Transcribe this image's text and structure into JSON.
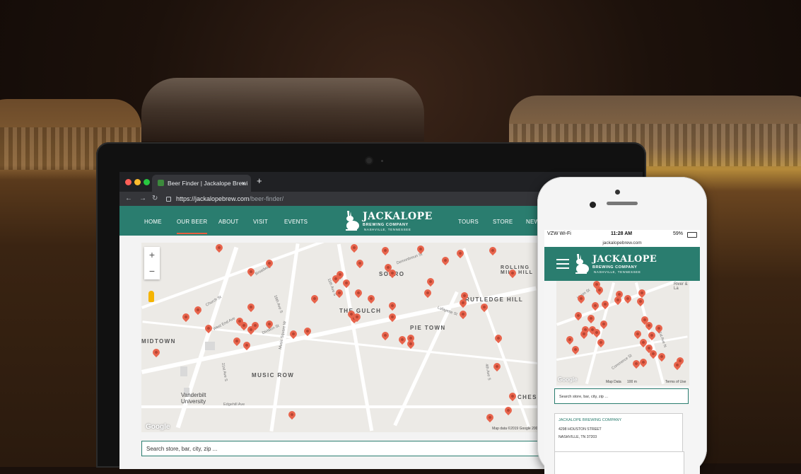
{
  "browser": {
    "tab_title": "Beer Finder | Jackalope Brewi",
    "tab_close": "×",
    "new_tab": "+",
    "url_host": "https://jackalopebrew.com",
    "url_path": "/beer-finder/",
    "traffic_lights": [
      "#ff5f57",
      "#febc2e",
      "#28c840"
    ]
  },
  "site": {
    "nav_left": [
      "HOME",
      "OUR BEER",
      "ABOUT",
      "VISIT",
      "EVENTS"
    ],
    "nav_right": [
      "TOURS",
      "STORE",
      "NEW"
    ],
    "active_item": "OUR BEER",
    "logo": {
      "name": "JACKALOPE",
      "tagline": "BREWING COMPANY",
      "location": "NASHVILLE, TENNESSEE"
    },
    "brand_color": "#2a7d6f",
    "accent_color": "#e85d3f"
  },
  "map": {
    "zoom_in": "+",
    "zoom_out": "−",
    "labels": [
      "SOBRO",
      "THE GULCH",
      "PIE TOWN",
      "RUTLEDGE HILL",
      "ROLLING MILL HILL",
      "MIDTOWN",
      "MUSIC ROW",
      "Vanderbilt University",
      "CHEST"
    ],
    "streets": [
      "Broadway",
      "West End Ave",
      "Church St",
      "Demonbreun St",
      "11th Ave S",
      "Lafayette St",
      "16th Ave S",
      "21st Ave S",
      "Edgehill Ave",
      "Division St",
      "Music Square W",
      "4th Ave S"
    ],
    "google": "Google",
    "footer": "Map data ©2019 Google   200 m"
  },
  "search": {
    "placeholder": "Search store, bar, city, zip ..."
  },
  "phone": {
    "carrier": "VZW Wi-Fi",
    "time": "11:28 AM",
    "battery": "59%",
    "url": "jackalopebrew.com",
    "map_labels": [
      "River & La",
      "Union St",
      "Commerce St",
      "1st Ave N"
    ],
    "map_footer": "Map Data",
    "map_scale": "100 m",
    "terms": "Terms of Use",
    "google": "Google",
    "search_placeholder": "Search store, bar, city, zip ...",
    "result": {
      "name": "JACKALOPE BREWING COMPANY",
      "address": "4298 HOUSTON STREET",
      "city": "NASHVILLE, TN 37203"
    }
  }
}
